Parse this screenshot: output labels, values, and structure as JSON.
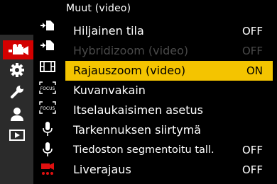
{
  "header": {
    "title": "Muut (video)"
  },
  "menu": {
    "items": [
      {
        "label": "Hiljainen tila",
        "value": "OFF",
        "state": "normal"
      },
      {
        "label": "Hybridizoom (video)",
        "value": "OFF",
        "state": "disabled"
      },
      {
        "label": "Rajauszoom (video)",
        "value": "ON",
        "state": "selected"
      },
      {
        "label": "Kuvanvakain",
        "value": "",
        "state": "normal"
      },
      {
        "label": "Itselaukaisimen asetus",
        "value": "",
        "state": "normal"
      },
      {
        "label": "Tarkennuksen siirtymä",
        "value": "",
        "state": "normal"
      },
      {
        "label": "Tiedoston segmentoitu tall.",
        "value": "OFF",
        "state": "normal"
      },
      {
        "label": "Liverajaus",
        "value": "OFF",
        "state": "normal"
      }
    ]
  },
  "tabs": [
    "video-camera-icon",
    "gear-icon",
    "wrench-icon",
    "person-icon",
    "playback-icon"
  ],
  "subtabs": [
    "video-file-icon",
    "video-file-icon",
    "film-icon",
    "focus-icon",
    "focus-icon",
    "microphone-icon",
    "microphone-icon",
    "video-camera-dots-icon"
  ],
  "colors": {
    "selected": "#f4c400",
    "active_tab": "#d30000",
    "disabled_text": "#4a4a4a",
    "tab_bar": "#2b2b2b"
  }
}
